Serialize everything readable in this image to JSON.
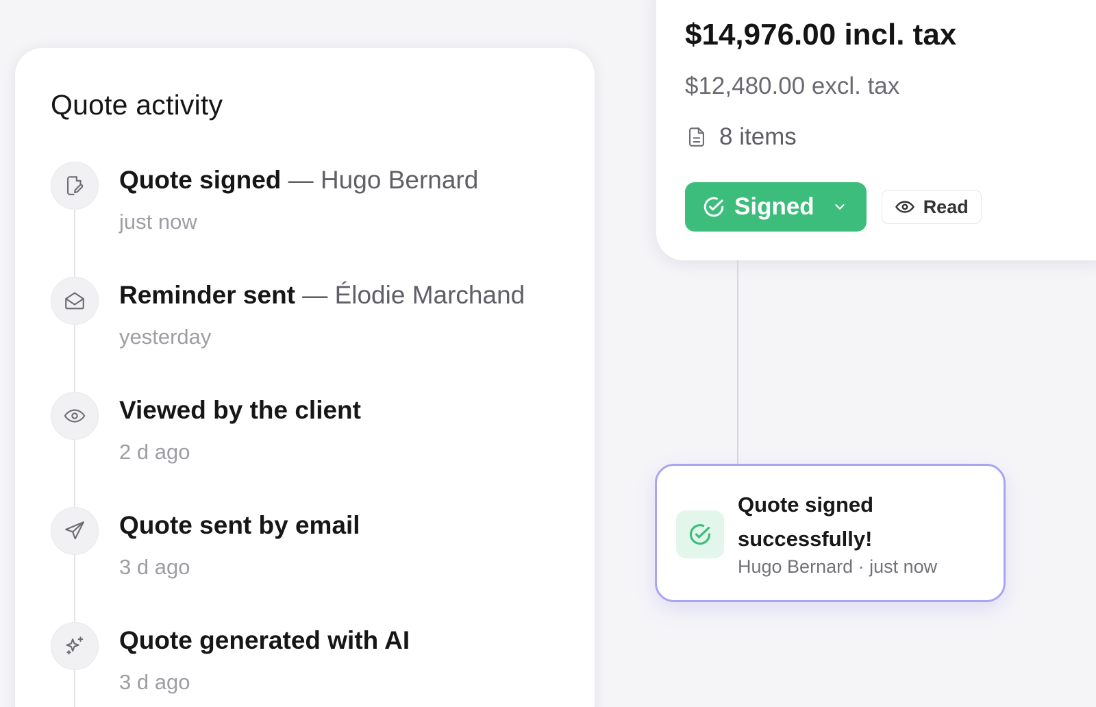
{
  "activity": {
    "title": "Quote activity",
    "events": [
      {
        "title": "Quote signed",
        "actor": " — Hugo Bernard",
        "time": "just now",
        "icon": "signed-document-icon"
      },
      {
        "title": "Reminder sent",
        "actor": " — Élodie Marchand",
        "time": "yesterday",
        "icon": "open-envelope-icon"
      },
      {
        "title": "Viewed by the client",
        "actor": "",
        "time": "2 d ago",
        "icon": "eye-icon"
      },
      {
        "title": "Quote sent by email",
        "actor": "",
        "time": "3 d ago",
        "icon": "paper-plane-icon"
      },
      {
        "title": "Quote generated with AI",
        "actor": "",
        "time": "3 d ago",
        "icon": "sparkles-icon"
      }
    ]
  },
  "quote": {
    "total_incl_tax": "$14,976.00 incl. tax",
    "total_excl_tax": "$12,480.00 excl. tax",
    "items": "8 items",
    "status_label": "Signed",
    "read_label": "Read"
  },
  "toast": {
    "title": "Quote signed successfully!",
    "meta": "Hugo Bernard · just now"
  },
  "colors": {
    "signed_green": "#3dbd7c",
    "toast_border": "#a8a5f3",
    "background": "#f5f5f8"
  }
}
